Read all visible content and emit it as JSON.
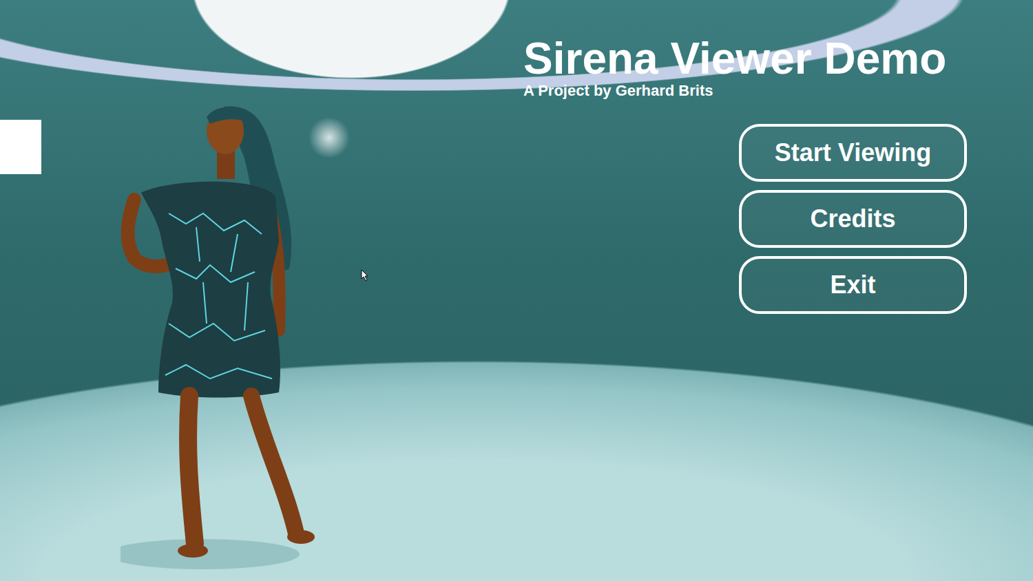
{
  "title": "Sirena Viewer Demo",
  "subtitle": "A Project by Gerhard Brits",
  "menu": [
    {
      "label": "Start Viewing"
    },
    {
      "label": "Credits"
    },
    {
      "label": "Exit"
    }
  ]
}
